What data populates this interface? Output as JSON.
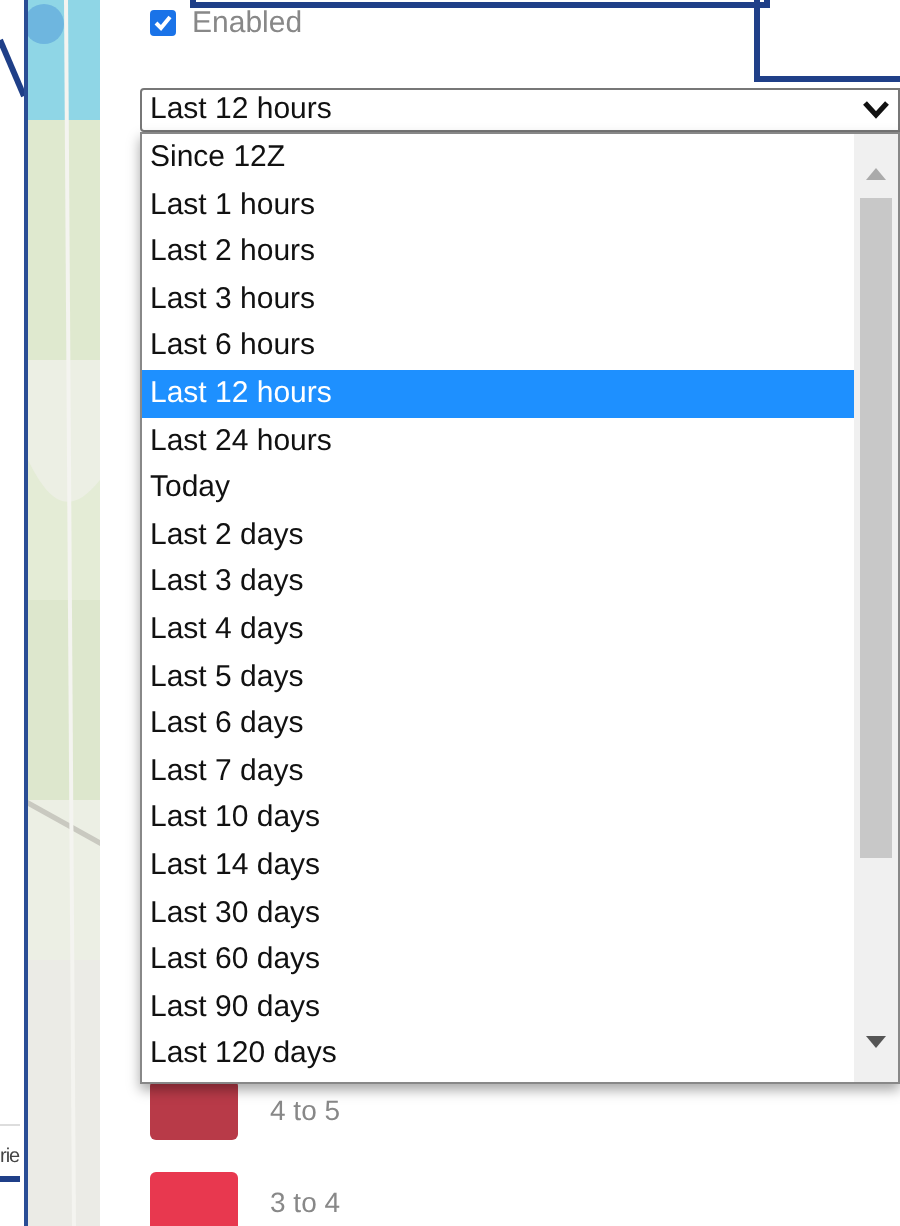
{
  "side_label": "rie",
  "enabled": {
    "label": "Enabled",
    "checked": true
  },
  "time_range": {
    "value": "Last 12 hours",
    "expanded": true,
    "options": [
      {
        "label": "Since 12Z",
        "selected": false
      },
      {
        "label": "Last 1 hours",
        "selected": false
      },
      {
        "label": "Last 2 hours",
        "selected": false
      },
      {
        "label": "Last 3 hours",
        "selected": false
      },
      {
        "label": "Last 6 hours",
        "selected": false
      },
      {
        "label": "Last 12 hours",
        "selected": true
      },
      {
        "label": "Last 24 hours",
        "selected": false
      },
      {
        "label": "Today",
        "selected": false
      },
      {
        "label": "Last 2 days",
        "selected": false
      },
      {
        "label": "Last 3 days",
        "selected": false
      },
      {
        "label": "Last 4 days",
        "selected": false
      },
      {
        "label": "Last 5 days",
        "selected": false
      },
      {
        "label": "Last 6 days",
        "selected": false
      },
      {
        "label": "Last 7 days",
        "selected": false
      },
      {
        "label": "Last 10 days",
        "selected": false
      },
      {
        "label": "Last 14 days",
        "selected": false
      },
      {
        "label": "Last 30 days",
        "selected": false
      },
      {
        "label": "Last 60 days",
        "selected": false
      },
      {
        "label": "Last 90 days",
        "selected": false
      },
      {
        "label": "Last 120 days",
        "selected": false
      }
    ]
  },
  "legend": [
    {
      "label": "4 to 5",
      "color": "#b83a48"
    },
    {
      "label": "3 to 4",
      "color": "#e8384f"
    }
  ]
}
